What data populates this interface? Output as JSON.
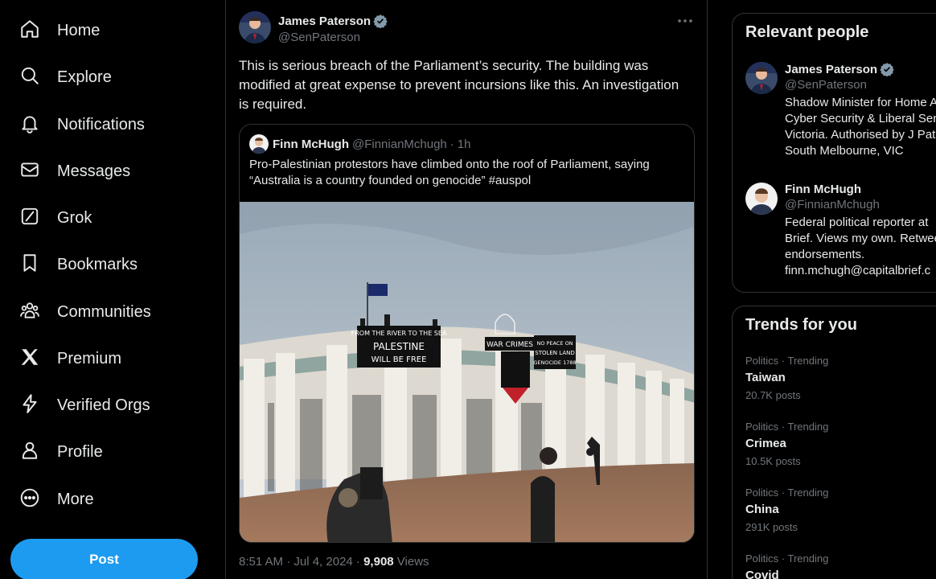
{
  "nav": {
    "items": [
      {
        "label": "Home",
        "icon": "home-icon"
      },
      {
        "label": "Explore",
        "icon": "search-icon"
      },
      {
        "label": "Notifications",
        "icon": "bell-icon"
      },
      {
        "label": "Messages",
        "icon": "envelope-icon"
      },
      {
        "label": "Grok",
        "icon": "grok-icon"
      },
      {
        "label": "Bookmarks",
        "icon": "bookmark-icon"
      },
      {
        "label": "Communities",
        "icon": "people-icon"
      },
      {
        "label": "Premium",
        "icon": "x-logo-icon"
      },
      {
        "label": "Verified Orgs",
        "icon": "lightning-icon"
      },
      {
        "label": "Profile",
        "icon": "person-icon"
      },
      {
        "label": "More",
        "icon": "more-circle-icon"
      }
    ],
    "post_label": "Post"
  },
  "tweet": {
    "author_name": "James Paterson",
    "author_handle": "@SenPaterson",
    "text": "This is serious breach of the Parliament’s security. The building was modified at great expense to prevent incursions like this. An investigation is required.",
    "quote": {
      "author_name": "Finn McHugh",
      "author_handle": "@FinnianMchugh",
      "separator": "·",
      "time": "1h",
      "text": "Pro-Palestinian protestors have climbed onto the roof of Parliament, saying “Australia is a country founded on genocide” #auspol",
      "banners": {
        "main_line1": "FROM THE RIVER TO THE SEA",
        "main_line2": "PALESTINE",
        "main_line3": "WILL BE FREE",
        "left": "WAR CRIMES",
        "right_line1": "NO PEACE ON",
        "right_line2": "STOLEN LAND",
        "right_line3": "GENOCIDE 1788"
      }
    },
    "timestamp": "8:51 AM · Jul 4, 2024 · ",
    "views_count": "9,908",
    "views_label": " Views"
  },
  "relevant": {
    "title": "Relevant people",
    "people": [
      {
        "name": "James Paterson",
        "handle": "@SenPaterson",
        "bio": "Shadow Minister for Home A\nCyber Security & Liberal Sen\nVictoria. Authorised by J Pat\nSouth Melbourne, VIC"
      },
      {
        "name": "Finn McHugh",
        "handle": "@FinnianMchugh",
        "bio": "Federal political reporter at\nBrief. Views my own. Retwee\nendorsements.\nfinn.mchugh@capitalbrief.c"
      }
    ]
  },
  "trends": {
    "title": "Trends for you",
    "items": [
      {
        "category": "Politics · Trending",
        "name": "Taiwan",
        "count": "20.7K posts"
      },
      {
        "category": "Politics · Trending",
        "name": "Crimea",
        "count": "10.5K posts"
      },
      {
        "category": "Politics · Trending",
        "name": "China",
        "count": "291K posts"
      },
      {
        "category": "Politics · Trending",
        "name": "Covid",
        "count": ""
      }
    ]
  },
  "colors": {
    "accent": "#1d9bf0",
    "background": "#000000",
    "text": "#e7e9ea",
    "muted": "#71767b",
    "border": "#2f3336"
  }
}
